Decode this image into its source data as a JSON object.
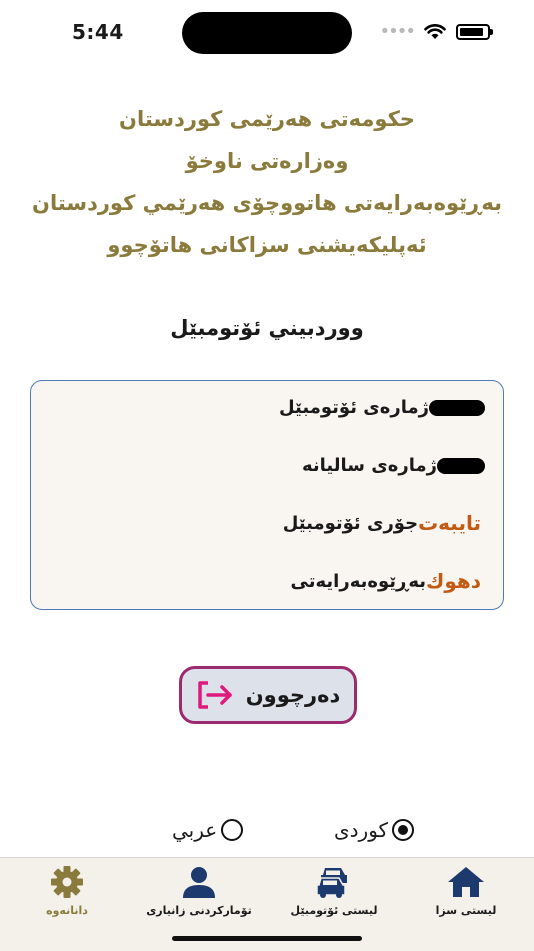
{
  "status_bar": {
    "time": "5:44",
    "battery_level": 0.9
  },
  "header": {
    "lines": [
      "حکومەتی هەرێمی کوردستان",
      "وەزارەتی ناوخۆ",
      "بەڕێوەبەرایەتی هاتووچۆی هەرێمي کوردستان",
      "ئەپلیکەیشنی سزاکانی هاتۆچوو"
    ]
  },
  "page_title": "ووردبيني ئۆتومبێل",
  "vehicle": {
    "plate_label": "ژمارەی ئۆتومبێل",
    "serial_label": "ژمارەی سالیانە",
    "type_label": "جۆری ئۆتومبێل",
    "type_value": "تایبەت",
    "directorate_label": "بەڕێوەبەرایەتی",
    "directorate_value": "دهوك"
  },
  "exit_button": {
    "label": "دەرچوون"
  },
  "language": {
    "kurdish": "کوردی",
    "arabic": "عربي",
    "selected": "kurdish"
  },
  "tabs": [
    {
      "label": "لیستی سزا",
      "icon": "home-icon"
    },
    {
      "label": "لیستی ئۆتومبێل",
      "icon": "cars-icon"
    },
    {
      "label": "تۆمارکردنی زانیاری",
      "icon": "user-icon"
    },
    {
      "label": "دانانەوە",
      "icon": "gear-icon"
    }
  ],
  "colors": {
    "header_gold": "#8a7a3b",
    "value_orange": "#c25a12",
    "card_border": "#4d7bb5",
    "button_border": "#9c2a6f",
    "icon_navy": "#1d3a6e",
    "exit_pink": "#e0197d"
  }
}
